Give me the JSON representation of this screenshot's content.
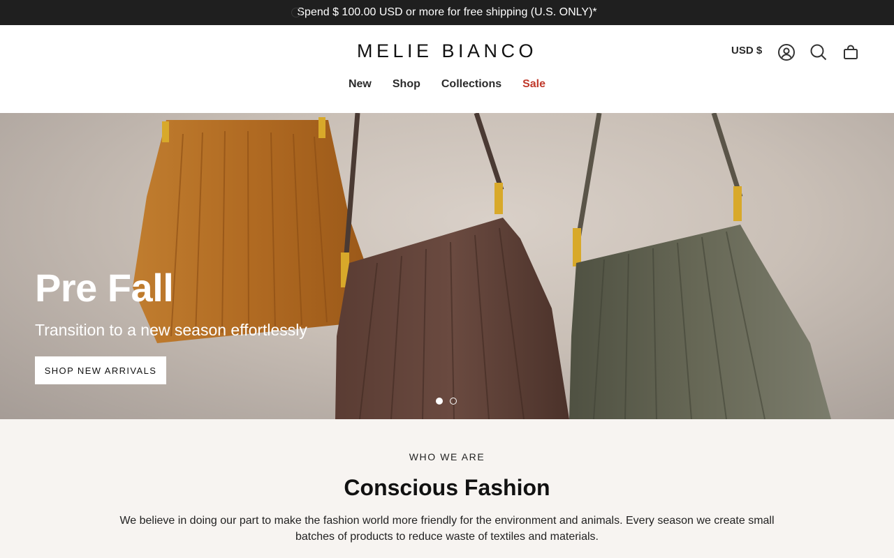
{
  "announcement": {
    "text": "Spend $ 100.00 USD or more for free shipping (U.S. ONLY)*"
  },
  "header": {
    "logo": "MELIE BIANCO",
    "currency": "USD $",
    "icons": [
      "account-icon",
      "search-icon",
      "cart-icon"
    ],
    "nav": [
      {
        "label": "New"
      },
      {
        "label": "Shop"
      },
      {
        "label": "Collections"
      },
      {
        "label": "Sale",
        "color": "#c0392b"
      }
    ]
  },
  "hero": {
    "title": "Pre Fall",
    "subtitle": "Transition to a new season effortlessly",
    "cta": "SHOP NEW ARRIVALS",
    "slides": {
      "current": 1,
      "total": 2
    }
  },
  "about": {
    "eyebrow": "WHO WE ARE",
    "heading": "Conscious Fashion",
    "body": "We believe in doing our part to make the fashion world more friendly for the environment and animals. Every season we create small batches of products to reduce waste of textiles and materials."
  },
  "colors": {
    "announcement_bg": "#1f1f1f",
    "sale": "#c0392b",
    "about_bg": "#f7f4f1",
    "bag_tan": "#b8742a",
    "bag_brown": "#5e4036",
    "bag_olive": "#5f604e",
    "hardware_gold": "#d8a92a"
  }
}
